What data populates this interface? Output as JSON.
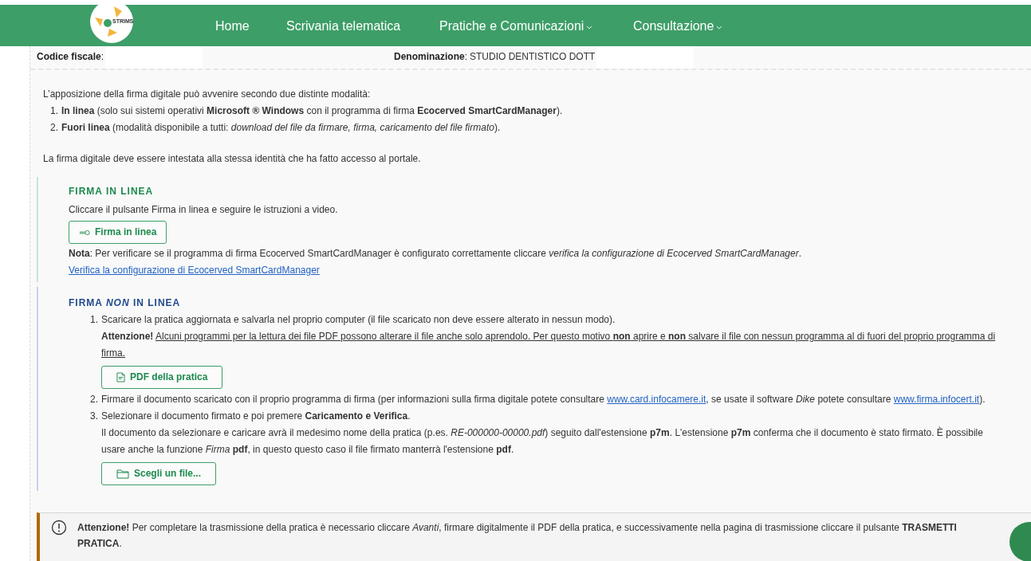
{
  "nav": {
    "logo_text": "STRIMS",
    "items": [
      {
        "label": "Home",
        "dropdown": false
      },
      {
        "label": "Scrivania telematica",
        "dropdown": false
      },
      {
        "label": "Pratiche e Comunicazioni",
        "dropdown": true
      },
      {
        "label": "Consultazione",
        "dropdown": true
      }
    ]
  },
  "info": [
    {
      "label": "**Codice fiscale**:"
    },
    {
      "label": "**Denominazione**:",
      "value": "STUDIO DENTISTICO DOTT"
    }
  ],
  "intro": {
    "text": "L’apposizione della firma digitale può avvenire secondo due distinte modalità:",
    "mode_numbers": [
      "1.",
      "2."
    ],
    "modes": [
      "**In linea** (solo sui sistemi operativi **Microsoft ® Windows** con il programma di firma **Ecocerved SmartCardManager**).",
      "**Fuori linea** (modalità disponibile a tutti: *download del file da firmare, firma, caricamento del file firmato*)."
    ],
    "identity": "La firma digitale deve essere intestata alla stessa identità che ha fatto accesso al portale."
  },
  "online": {
    "title": "FIRMA IN LINEA",
    "instruction": "Cliccare il pulsante Firma in linea e seguire le istruzioni a video.",
    "button": "Firma in linea",
    "note": "**Nota**: Per verificare se il programma di firma Ecocerved SmartCardManager è configurato correttamente cliccare *verifica la configurazione di Ecocerved SmartCardManager*.",
    "link": "Verifica la configurazione di Ecocerved SmartCardManager"
  },
  "offline": {
    "title": "FIRMA *NON* IN LINEA",
    "steps": [
      {
        "number": "1.",
        "parts": [
          {
            "kind": "text",
            "text": "Scaricare la pratica aggiornata e salvarla nel proprio computer (il file scaricato non deve essere alterato in nessun modo)."
          }
        ],
        "warning_label": "Attenzione!",
        "warning": "Alcuni programmi per la lettura dei file PDF possono alterare il file anche solo aprendolo. Per questo motivo **non** aprire e **non** salvare il file con nessun programma al di fuori del proprio programma di firma.",
        "button": {
          "kind": "document",
          "label": "PDF della pratica"
        }
      },
      {
        "number": "2.",
        "parts": [
          {
            "kind": "text",
            "text": "Firmare il documento scaricato con il proprio programma di firma (per informazioni sulla firma digitale potete consultare "
          },
          {
            "kind": "link",
            "text": "www.card.infocamere.it"
          },
          {
            "kind": "text",
            "text": ", se usate il software *Dike* potete consultare "
          },
          {
            "kind": "link",
            "text": "www.firma.infocert.it"
          },
          {
            "kind": "text",
            "text": ")."
          }
        ]
      },
      {
        "number": "3.",
        "parts": [
          {
            "kind": "text",
            "text": "Selezionare il documento firmato e poi premere **Caricamento e Verifica**."
          }
        ],
        "detail": "Il documento da selezionare e caricare avrà il medesimo nome della pratica (p.es. *RE-000000-00000.pdf*) seguito dall'estensione **p7m**. L'estensione **p7m** conferma che il documento è stato firmato. È possibile usare anche la funzione *Firma* **pdf**, in questo questo caso il file firmato manterrà l'estensione **pdf**.",
        "button": {
          "kind": "folder",
          "label": "Scegli un file..."
        }
      }
    ]
  },
  "alert": {
    "text": "**Attenzione!** Per completare la trasmissione della pratica è necessario cliccare *Avanti*, firmare digitalmente il PDF della pratica, e successivamente nella pagina di trasmissione cliccare il pulsante **TRASMETTI PRATICA**."
  }
}
